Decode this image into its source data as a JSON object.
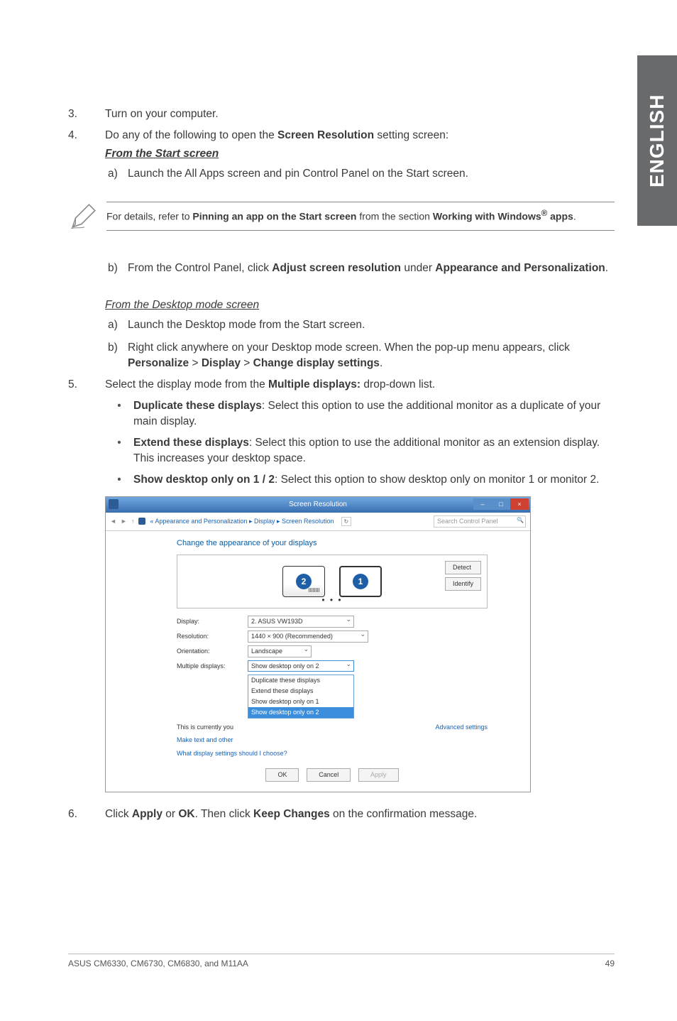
{
  "side_tab": "ENGLISH",
  "steps": {
    "s3_num": "3.",
    "s3_text": "Turn on your computer.",
    "s4_num": "4.",
    "s4_text_a": "Do any of the following to open the ",
    "s4_bold": "Screen Resolution",
    "s4_text_b": " setting screen:",
    "s4_from_start": "From the Start screen",
    "s4a_lbl": "a)",
    "s4a_text": "Launch the All Apps screen and pin Control Panel on the Start screen.",
    "note_a": "For details, refer to ",
    "note_b": "Pinning an app on the Start screen",
    "note_c": " from the section ",
    "note_d": "Working with Windows",
    "note_reg": "®",
    "note_e": " apps",
    "note_f": ".",
    "s4b_lbl": "b)",
    "s4b_a": "From the Control Panel, click ",
    "s4b_b": "Adjust screen resolution",
    "s4b_c": " under ",
    "s4b_d": "Appearance and Personalization",
    "s4b_e": ".",
    "s4_from_desktop": "From the Desktop mode screen",
    "s4da_lbl": "a)",
    "s4da_text": "Launch the Desktop mode from the Start screen.",
    "s4db_lbl": "b)",
    "s4db_a": "Right click anywhere on your Desktop mode screen. When the pop-up menu appears, click ",
    "s4db_b": "Personalize",
    "s4db_c": " > ",
    "s4db_d": "Display",
    "s4db_e": " > ",
    "s4db_f": "Change display settings",
    "s4db_g": ".",
    "s5_num": "5.",
    "s5_a": "Select the display mode from the ",
    "s5_b": "Multiple displays:",
    "s5_c": " drop-down list.",
    "b1_t": "Duplicate these displays",
    "b1_r": ": Select this option to use the additional monitor as a duplicate of your main display.",
    "b2_t": "Extend these displays",
    "b2_r": ": Select this option to use the additional monitor as an extension display. This increases your desktop space.",
    "b3_t": "Show desktop only on 1 / 2",
    "b3_r": ": Select this option to show desktop only on monitor 1 or monitor 2.",
    "s6_num": "6.",
    "s6_a": "Click ",
    "s6_b": "Apply",
    "s6_c": " or ",
    "s6_d": "OK",
    "s6_e": ". Then click ",
    "s6_f": "Keep Changes",
    "s6_g": " on the confirmation message."
  },
  "mock": {
    "title": "Screen Resolution",
    "min": "–",
    "max": "□",
    "close": "×",
    "nav_back": "◄",
    "nav_fwd": "►",
    "nav_up": "↑",
    "crumb": "« Appearance and Personalization ▸ Display ▸ Screen Resolution",
    "refresh": "↻",
    "search_ph": "Search Control Panel",
    "heading": "Change the appearance of your displays",
    "badge1": "1",
    "badge2": "2",
    "dots": "• • •",
    "detect": "Detect",
    "identify": "Identify",
    "lbl_display": "Display:",
    "val_display": "2. ASUS VW193D",
    "lbl_res": "Resolution:",
    "val_res": "1440 × 900 (Recommended)",
    "lbl_orient": "Orientation:",
    "val_orient": "Landscape",
    "lbl_mult": "Multiple displays:",
    "val_mult": "Show desktop only on 2",
    "opt1": "Duplicate these displays",
    "opt2": "Extend these displays",
    "opt3": "Show desktop only on 1",
    "opt4": "Show desktop only on 2",
    "txt_currently": "This is currently you",
    "adv": "Advanced settings",
    "make_text": "Make text and other",
    "what": "What display settings should I choose?",
    "ok": "OK",
    "cancel": "Cancel",
    "apply": "Apply"
  },
  "footer": {
    "left": "ASUS CM6330, CM6730, CM6830, and M11AA",
    "right": "49"
  }
}
